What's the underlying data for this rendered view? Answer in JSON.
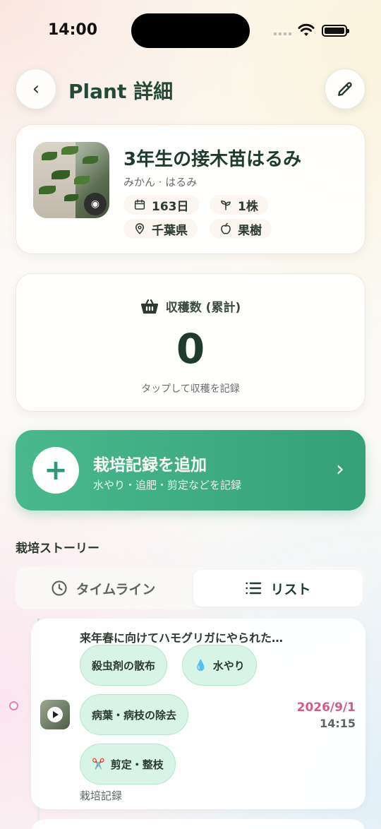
{
  "status": {
    "time": "14:00"
  },
  "header": {
    "back_icon": "‹",
    "title": "Plant 詳細"
  },
  "plant": {
    "name": "3年生の接木苗はるみ",
    "subtitle": "みかん · はるみ",
    "days": "163日",
    "count": "1株",
    "location": "千葉県",
    "category": "果樹"
  },
  "harvest": {
    "label": "収穫数 (累計)",
    "value": "0",
    "hint": "タップして収穫を記録"
  },
  "add_record": {
    "plus": "+",
    "title": "栽培記録を追加",
    "subtitle": "水やり・追肥・剪定などを記録",
    "chevron": "›"
  },
  "story": {
    "section_title": "栽培ストーリー",
    "tabs": {
      "timeline": "タイムライン",
      "list": "リスト"
    },
    "selected_tab": "list"
  },
  "entry": {
    "title": "来年春に向けてハモグリガにやられた…",
    "tags": {
      "pesticide": "殺虫剤の散布",
      "water": "水やり",
      "water_icon": "💧",
      "disease": "病葉・病枝の除去",
      "prune": "剪定・整枝",
      "prune_icon": "✂️"
    },
    "date": "2026/9/1",
    "time": "14:15",
    "kind": "栽培記録"
  },
  "colors": {
    "accent_green": "#3aa87e",
    "date_pink": "#d05d86",
    "tag_bg": "#d8f4e6",
    "title_green": "#234a36"
  }
}
